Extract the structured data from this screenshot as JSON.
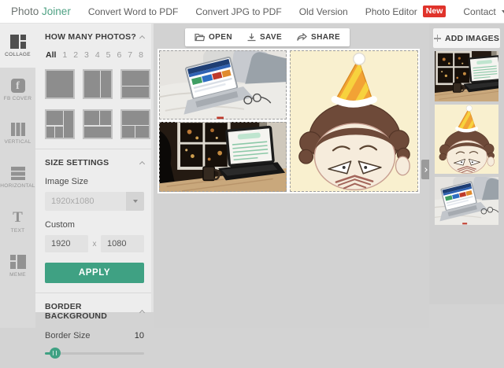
{
  "navbar": {
    "logo_part1": "Photo",
    "logo_part2": "Joiner",
    "links": [
      {
        "label": "Convert Word to PDF"
      },
      {
        "label": "Convert JPG to PDF"
      },
      {
        "label": "Old Version"
      },
      {
        "label": "Photo Editor"
      },
      {
        "label": "Contact"
      }
    ],
    "new_badge": "New"
  },
  "sidebar": {
    "active_item": "COLLAGE",
    "items": [
      {
        "label": "COLLAGE"
      },
      {
        "label": "FB COVER"
      },
      {
        "label": "VERTICAL"
      },
      {
        "label": "HORIZONTAL"
      },
      {
        "label": "TEXT"
      },
      {
        "label": "MEME"
      }
    ],
    "icon_glyphs": {
      "fb": "f",
      "text": "T"
    }
  },
  "panel": {
    "photos": {
      "title": "HOW MANY PHOTOS?",
      "filters": [
        "All",
        "1",
        "2",
        "3",
        "4",
        "5",
        "6",
        "7",
        "8"
      ],
      "active_filter": "All"
    },
    "size": {
      "title": "SIZE SETTINGS",
      "image_size_label": "Image Size",
      "image_size_value": "1920x1080",
      "custom_label": "Custom",
      "width_value": "1920",
      "separator": "x",
      "height_value": "1080",
      "apply_label": "APPLY"
    },
    "border": {
      "title": "BORDER BACKGROUND",
      "size_label": "Border Size",
      "size_value": "10"
    }
  },
  "toolbar": {
    "open_label": "OPEN",
    "save_label": "SAVE",
    "share_label": "SHARE"
  },
  "right_panel": {
    "add_images_label": "ADD IMAGES"
  },
  "canvas": {
    "images": [
      {
        "name": "laptop-on-bed-photo"
      },
      {
        "name": "laptop-on-desk-night-photo"
      },
      {
        "name": "cartoon-party-hat-face"
      }
    ]
  },
  "colors": {
    "accent_green": "#3fa183",
    "badge_red": "#e0332b",
    "panel_bg": "#ededed",
    "canvas_bg": "#d2d2d2"
  }
}
